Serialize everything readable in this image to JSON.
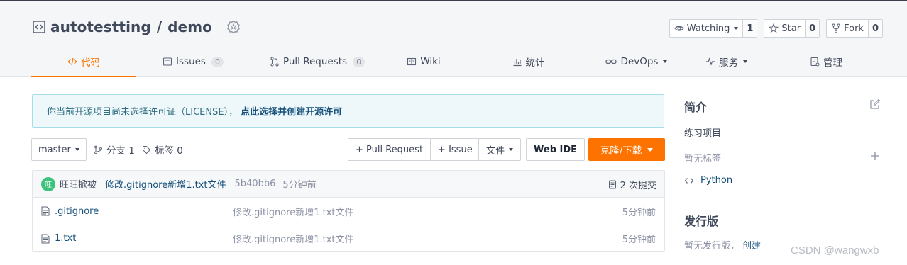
{
  "repo": {
    "owner": "autotestting",
    "separator": "/",
    "name": "demo"
  },
  "actions": {
    "watch_label": "Watching",
    "watch_count": "1",
    "star_label": "Star",
    "star_count": "0",
    "fork_label": "Fork",
    "fork_count": "0"
  },
  "tabs": [
    {
      "label": "代码",
      "active": true
    },
    {
      "label": "Issues",
      "count": "0"
    },
    {
      "label": "Pull Requests",
      "count": "0"
    },
    {
      "label": "Wiki"
    },
    {
      "label": "统计"
    },
    {
      "label": "DevOps"
    },
    {
      "label": "服务"
    },
    {
      "label": "管理"
    }
  ],
  "notice": {
    "text": "你当前开源项目尚未选择许可证（LICENSE），",
    "link": "点此选择并创建开源许可"
  },
  "toolbar": {
    "branch": "master",
    "branches": "分支 1",
    "tags": "标签 0",
    "pull_request_button": "+ Pull Request",
    "issue_button": "+ Issue",
    "file_button": "文件",
    "webide_button": "Web IDE",
    "clone_button": "克隆/下载"
  },
  "latest_commit": {
    "avatar_text": "旺",
    "author": "旺旺掀被",
    "message": "修改.gitignore新增1.txt文件",
    "sha": "5b40bb6",
    "time": "5分钟前",
    "count_label": "2 次提交"
  },
  "files": [
    {
      "name": ".gitignore",
      "message": "修改.gitignore新增1.txt文件",
      "time": "5分钟前"
    },
    {
      "name": "1.txt",
      "message": "修改.gitignore新增1.txt文件",
      "time": "5分钟前"
    }
  ],
  "sidebar": {
    "intro_heading": "简介",
    "description": "练习项目",
    "no_tags": "暂无标签",
    "language": "Python",
    "release_heading": "发行版",
    "no_release": "暂无发行版，",
    "create_link": "创建"
  },
  "watermark": "CSDN @wangwxb",
  "colors": {
    "accent": "#fe7300",
    "link": "#15507a",
    "notice_bg": "#eef8fb",
    "avatar": "#3cc27a"
  }
}
